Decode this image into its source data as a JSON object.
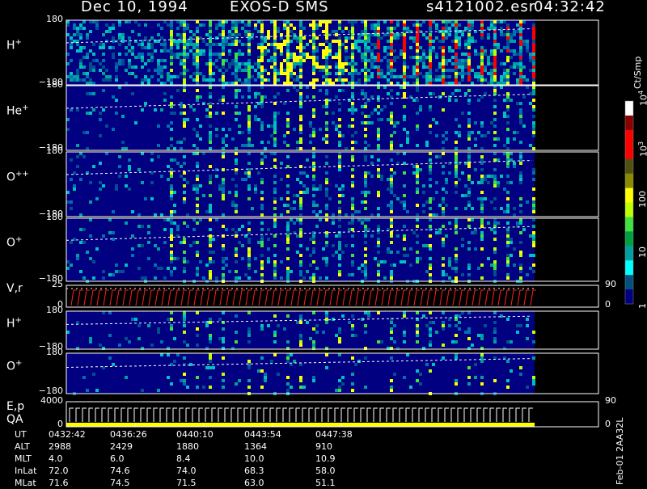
{
  "header": {
    "date": "Dec 10, 1994",
    "instrument": "EXOS-D SMS",
    "file": "s4121002.esr",
    "time": "04:32:42"
  },
  "panels": [
    {
      "label": "H",
      "sup": "+",
      "ytop": "180",
      "ybot": "−180"
    },
    {
      "label": "He",
      "sup": "+",
      "ytop": "180",
      "ybot": "−180"
    },
    {
      "label": "O",
      "sup": "++",
      "ytop": "180",
      "ybot": "−180"
    },
    {
      "label": "O",
      "sup": "+",
      "ytop": "180",
      "ybot": "−180"
    },
    {
      "label": "V,r",
      "sup": "",
      "ytop": "25",
      "ybot": "0",
      "rtop": "90",
      "rbot": "0"
    },
    {
      "label": "H",
      "sup": "+",
      "ytop": "180",
      "ybot": "−180"
    },
    {
      "label": "O",
      "sup": "+",
      "ytop": "180",
      "ybot": "−180"
    },
    {
      "label": "E,p",
      "label2": "QA",
      "sup": "",
      "ytop": "4000",
      "ybot": "0",
      "rtop": "90",
      "rbot": "0"
    }
  ],
  "colorbar": {
    "unit": "Ct/Smp",
    "ticks": [
      {
        "text": "1",
        "sup": "",
        "value": 1
      },
      {
        "text": "10",
        "sup": "",
        "value": 10
      },
      {
        "text": "100",
        "sup": "",
        "value": 100
      },
      {
        "text": "10",
        "sup": "3",
        "value": 1000
      },
      {
        "text": "10",
        "sup": "4",
        "value": 10000
      }
    ],
    "colors": [
      "#ffffff",
      "#8b0000",
      "#ff0000",
      "#ff0000",
      "#505010",
      "#8b8b00",
      "#ffff00",
      "#c0ff00",
      "#40e040",
      "#00a040",
      "#00a0a0",
      "#00ffff",
      "#005080",
      "#000080"
    ]
  },
  "orbit": {
    "rows": [
      {
        "name": "UT",
        "values": [
          "0432:42",
          "0436:26",
          "0440:10",
          "0443:54",
          "0447:38"
        ]
      },
      {
        "name": "ALT",
        "values": [
          "2988",
          "2429",
          "1880",
          "1364",
          "910"
        ]
      },
      {
        "name": "MLT",
        "values": [
          "4.0",
          "6.0",
          "8.4",
          "10.0",
          "10.9"
        ]
      },
      {
        "name": "InLat",
        "values": [
          "72.0",
          "74.6",
          "74.0",
          "68.3",
          "58.0"
        ]
      },
      {
        "name": "MLat",
        "values": [
          "71.6",
          "74.5",
          "71.5",
          "63.0",
          "51.1"
        ]
      }
    ]
  },
  "footer_id": "Feb-01 2AA32L",
  "chart_data": {
    "type": "heatmap",
    "title": "Dec 10, 1994 EXOS-D SMS",
    "x_ticks": [
      "0432:42",
      "0436:26",
      "0440:10",
      "0443:54",
      "0447:38"
    ],
    "data_end_fraction": 0.88,
    "colors": {
      "background": "#000080",
      "low": "#005090",
      "mid": "#00c0c0",
      "green": "#40e040",
      "yellow": "#ffff00",
      "red": "#ff0000"
    }
  }
}
